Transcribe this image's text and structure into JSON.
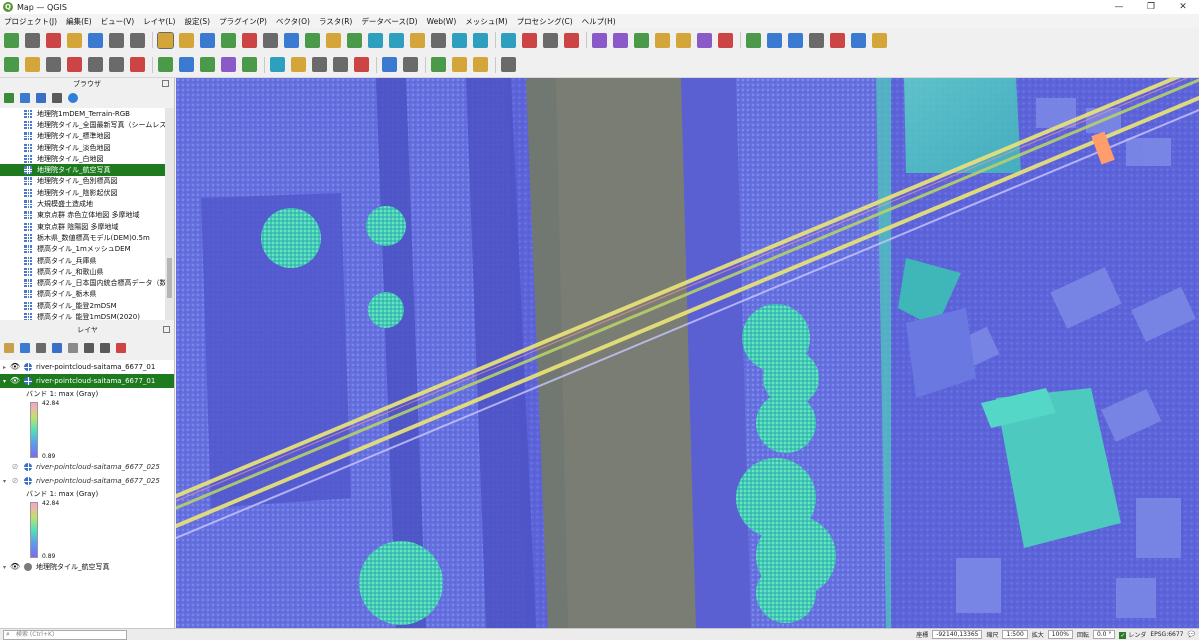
{
  "window": {
    "title": "Map — QGIS",
    "logo": "Q",
    "min": "—",
    "max": "❐",
    "close": "✕"
  },
  "menu": [
    "プロジェクト(J)",
    "編集(E)",
    "ビュー(V)",
    "レイヤ(L)",
    "設定(S)",
    "プラグイン(P)",
    "ベクタ(O)",
    "ラスタ(R)",
    "データベース(D)",
    "Web(W)",
    "メッシュ(M)",
    "プロセシング(C)",
    "ヘルプ(H)"
  ],
  "browser": {
    "title": "ブラウザ",
    "items": [
      "地理院1mDEM_Terrain-RGB",
      "地理院タイル_全国最新写真（シームレス）",
      "地理院タイル_標準地図",
      "地理院タイル_淡色地図",
      "地理院タイル_白地図",
      "地理院タイル_航空写真",
      "地理院タイル_色別標高図",
      "地理院タイル_陰影起伏図",
      "大規模盛土造成地",
      "東京点群 赤色立体地図 多摩地域",
      "東京点群 陰陽図 多摩地域",
      "栃木県_数値標高モデル(DEM)0.5m",
      "標高タイル_1mメッシュDEM",
      "標高タイル_兵庫県",
      "標高タイル_和歌山県",
      "標高タイル_日本国内統合標高データ（数値",
      "標高タイル_栃木県",
      "標高タイル_能登2mDSM",
      "標高タイル_能登1mDSM(2020)"
    ],
    "selected_index": 5
  },
  "layers": {
    "title": "レイヤ",
    "items": [
      {
        "name": "river-pointcloud-saitama_6677_01",
        "visible": true,
        "selected": false,
        "dim": false
      },
      {
        "name": "river-pointcloud-saitama_6677_01",
        "visible": true,
        "selected": true,
        "dim": false,
        "band": "バンド 1: max (Gray)",
        "max": "42.84",
        "min": "0.89"
      },
      {
        "name": "river-pointcloud-saitama_6677_025",
        "visible": false,
        "selected": false,
        "dim": true
      },
      {
        "name": "river-pointcloud-saitama_6677_025",
        "visible": false,
        "selected": false,
        "dim": true,
        "band": "バンド 1: max (Gray)",
        "max": "42.84",
        "min": "0.89"
      },
      {
        "name": "地理院タイル_航空写真",
        "visible": true,
        "selected": false,
        "dim": false
      }
    ]
  },
  "status": {
    "search_placeholder": "検索 (Ctrl+K)",
    "coord_label": "座標",
    "coord_value": "-92140,13365",
    "scale_label": "縮尺",
    "scale_value": "1:500",
    "magnifier_label": "拡大",
    "magnifier_value": "100%",
    "rotation_label": "回転",
    "rotation_value": "0.0 °",
    "render_label": "レンダ",
    "crs": "EPSG:6677"
  },
  "colors": {
    "accent_selected": "#1e7a1e",
    "ground": "#5b62d6",
    "river": "#7a7d74",
    "vegetation": "#4fe3b6",
    "powerline": "#e6e07a"
  },
  "toolbar_icons": {
    "row1": [
      "new-project-icon",
      "open-icon",
      "save-icon",
      "save-as-icon",
      "print-layout-icon",
      "layout-manager-icon",
      "style-manager-icon",
      "pan-icon",
      "pan-to-selection-icon",
      "zoom-in-icon",
      "zoom-out-icon",
      "zoom-full-icon",
      "zoom-selection-icon",
      "zoom-layer-icon",
      "zoom-native-icon",
      "zoom-last-icon",
      "zoom-next-icon",
      "new-map-view-icon",
      "new-3d-view-icon",
      "bookmark-new-icon",
      "bookmark-show-icon",
      "temporal-icon",
      "refresh-icon",
      "select-icon",
      "select-all-icon",
      "deselect-icon",
      "select-location-icon",
      "identify-icon",
      "actions-icon",
      "statistics-icon",
      "attribute-table-icon",
      "measure-icon",
      "annotation-icon",
      "map-tips-icon",
      "label-icon",
      "label-pin-icon",
      "label-highlight-icon",
      "label-show-icon",
      "label-move-icon",
      "label-rotate-icon",
      "label-change-icon"
    ],
    "row2": [
      "data-source-icon",
      "add-layer-icon",
      "add-vector-icon",
      "add-raster-icon",
      "add-mesh-icon",
      "add-wms-icon",
      "add-wfs-icon",
      "edit-pencil-icon",
      "digitize-icon",
      "add-point-icon",
      "vertex-tool-icon",
      "delete-feature-icon",
      "cut-icon",
      "copy-icon",
      "paste-icon",
      "undo-icon",
      "redo-icon",
      "georeferencer-icon",
      "qgis2web-icon",
      "python-icon",
      "grid-icon",
      "processing-icon",
      "help-icon"
    ]
  }
}
